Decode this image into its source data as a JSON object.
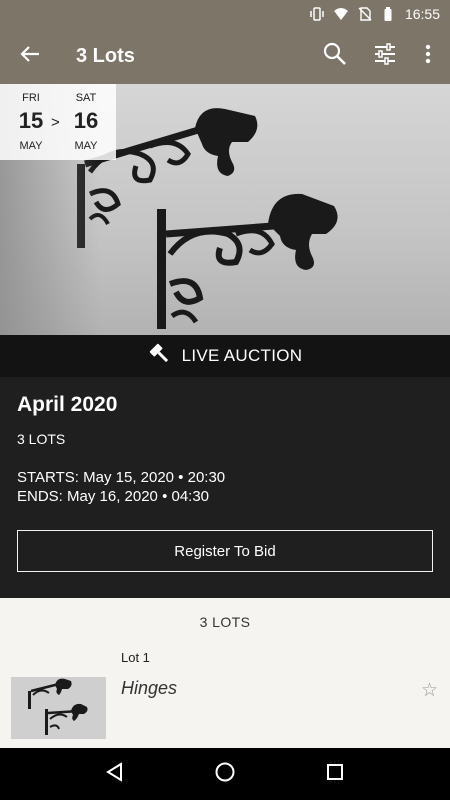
{
  "status_bar": {
    "time": "16:55",
    "icons": [
      "vibrate-icon",
      "wifi-icon",
      "no-sim-icon",
      "battery-icon"
    ]
  },
  "app_bar": {
    "title": "3 Lots",
    "icons": [
      "back-arrow-icon",
      "search-icon",
      "filter-icon",
      "more-vert-icon"
    ]
  },
  "date_range": {
    "start": {
      "day_of_week": "FRI",
      "day": "15",
      "month": "MAY"
    },
    "separator": ">",
    "end": {
      "day_of_week": "SAT",
      "day": "16",
      "month": "MAY"
    }
  },
  "live_band": {
    "icon": "gavel-icon",
    "label": "LIVE AUCTION"
  },
  "auction": {
    "name": "April 2020",
    "lot_count": "3 LOTS",
    "starts": "STARTS: May 15, 2020 • 20:30",
    "ends": "ENDS: May 16, 2020 • 04:30",
    "register_label": "Register To Bid"
  },
  "lots": {
    "heading": "3 LOTS",
    "items": [
      {
        "number": "Lot 1",
        "title": "Hinges",
        "favorite_icon": "star-outline-icon"
      }
    ]
  },
  "nav_bar": {
    "icons": [
      "back-triangle-icon",
      "home-circle-icon",
      "recents-square-icon"
    ]
  },
  "colors": {
    "app_bar": "#7c7568",
    "live_band": "#131313",
    "info_panel": "#1f1f1f",
    "lots_panel": "#f5f4f0",
    "nav_bar": "#000000"
  }
}
